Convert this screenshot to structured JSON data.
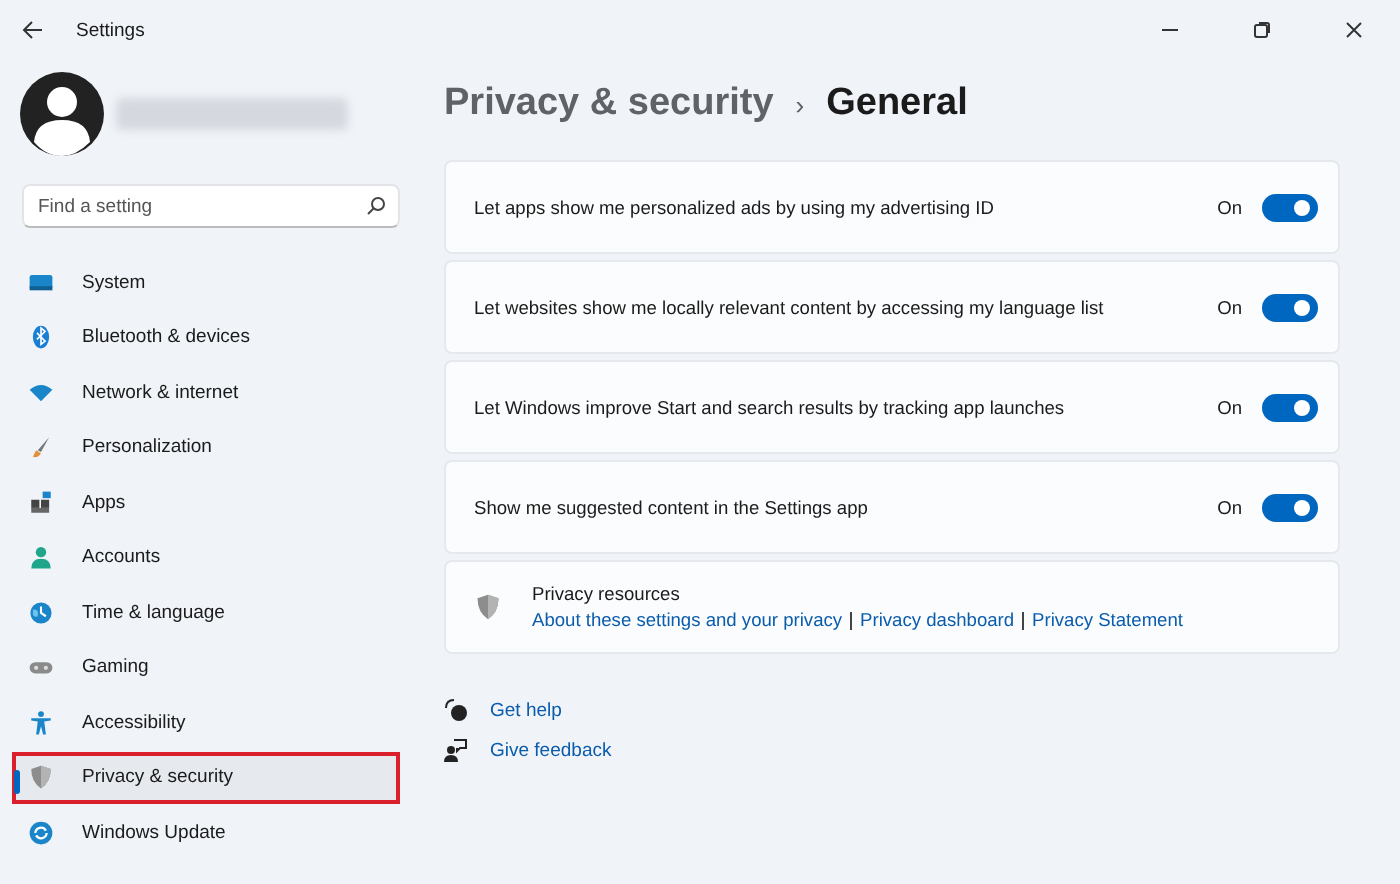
{
  "window": {
    "title": "Settings"
  },
  "search": {
    "placeholder": "Find a setting"
  },
  "nav": [
    {
      "label": "System",
      "selected": false,
      "framed": false
    },
    {
      "label": "Bluetooth & devices",
      "selected": false,
      "framed": false
    },
    {
      "label": "Network & internet",
      "selected": false,
      "framed": false
    },
    {
      "label": "Personalization",
      "selected": false,
      "framed": false
    },
    {
      "label": "Apps",
      "selected": false,
      "framed": false
    },
    {
      "label": "Accounts",
      "selected": false,
      "framed": false
    },
    {
      "label": "Time & language",
      "selected": false,
      "framed": false
    },
    {
      "label": "Gaming",
      "selected": false,
      "framed": false
    },
    {
      "label": "Accessibility",
      "selected": false,
      "framed": false
    },
    {
      "label": "Privacy & security",
      "selected": true,
      "framed": true
    },
    {
      "label": "Windows Update",
      "selected": false,
      "framed": false
    }
  ],
  "breadcrumb": {
    "parent": "Privacy & security",
    "separator": "›",
    "current": "General"
  },
  "settings": [
    {
      "label": "Let apps show me personalized ads by using my advertising ID",
      "state_text": "On",
      "on": true
    },
    {
      "label": "Let websites show me locally relevant content by accessing my language list",
      "state_text": "On",
      "on": true
    },
    {
      "label": "Let Windows improve Start and search results by tracking app launches",
      "state_text": "On",
      "on": true
    },
    {
      "label": "Show me suggested content in the Settings app",
      "state_text": "On",
      "on": true
    }
  ],
  "resources": {
    "title": "Privacy resources",
    "links": [
      "About these settings and your privacy",
      "Privacy dashboard",
      "Privacy Statement"
    ]
  },
  "help_links": [
    "Get help",
    "Give feedback"
  ]
}
